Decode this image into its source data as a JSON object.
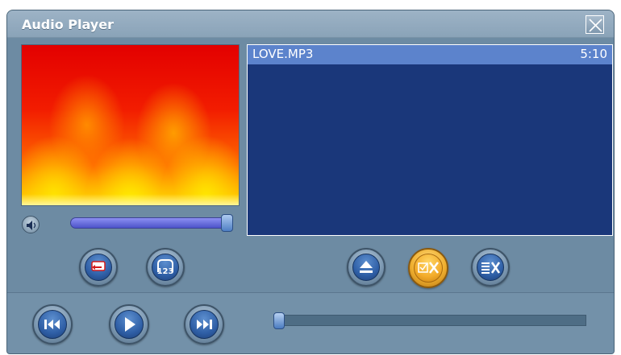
{
  "window": {
    "title": "Audio Player"
  },
  "playlist": {
    "tracks": [
      {
        "name": "LOVE.MP3",
        "duration": "5:10"
      }
    ]
  },
  "icons": {
    "close": "close-icon",
    "speaker": "speaker-icon",
    "repeat": "repeat-icon",
    "shuffle": "shuffle-icon",
    "eject": "eject-icon",
    "delete_selected": "delete-selected-icon",
    "clear_playlist": "clear-playlist-icon",
    "previous": "previous-track-icon",
    "play": "play-icon",
    "next": "next-track-icon"
  },
  "volume": {
    "level": 1.0
  },
  "seek": {
    "position": 0.0
  },
  "colors": {
    "playlist_bg": "#1a377a",
    "playlist_selected": "#5c83cc",
    "window_bg": "#6d8ba3",
    "active_button": "#f3ab2a"
  }
}
